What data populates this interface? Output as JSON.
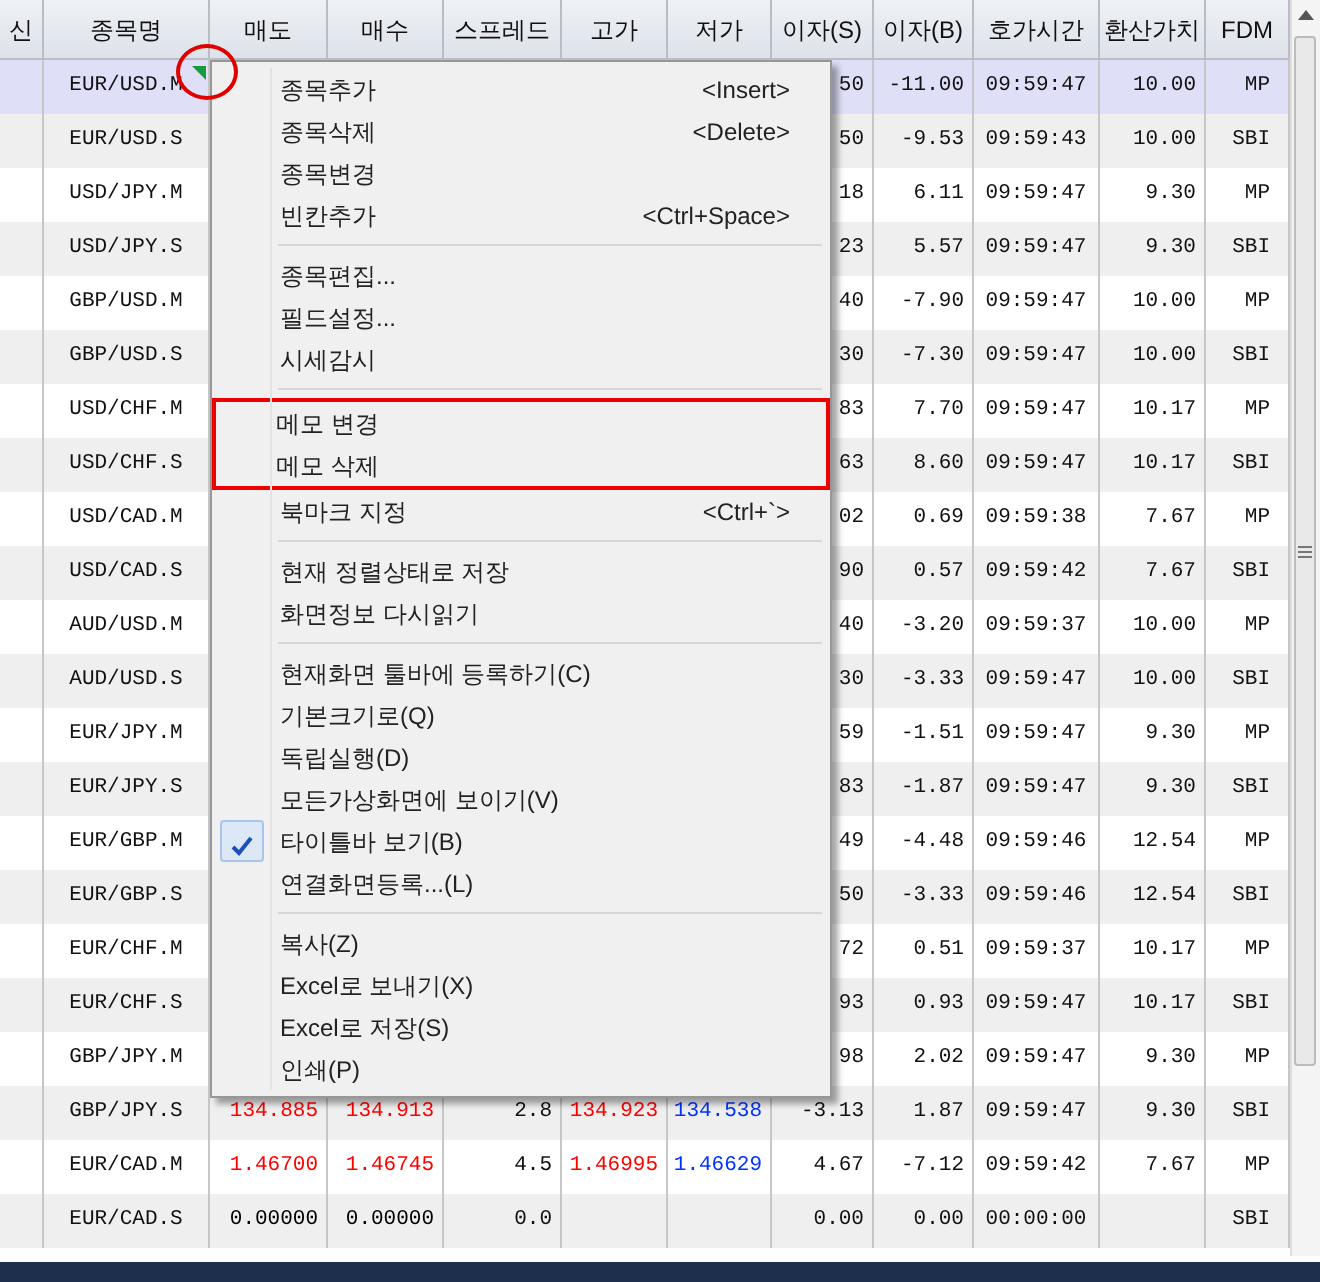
{
  "table": {
    "columns": [
      "신",
      "종목명",
      "매도",
      "매수",
      "스프레드",
      "고가",
      "저가",
      "이자(S)",
      "이자(B)",
      "호가시간",
      "환산가치",
      "FDM"
    ],
    "rows": [
      {
        "name": "EUR/USD.M",
        "interest_s": "50",
        "interest_b": "-11.00",
        "quote_time": "09:59:47",
        "converted_value": "10.00",
        "fdm": "MP",
        "selected": true,
        "memo": true
      },
      {
        "name": "EUR/USD.S",
        "interest_s": "50",
        "interest_b": "-9.53",
        "quote_time": "09:59:43",
        "converted_value": "10.00",
        "fdm": "SBI",
        "selected": false,
        "memo": false
      },
      {
        "name": "USD/JPY.M",
        "interest_s": "18",
        "interest_b": "6.11",
        "quote_time": "09:59:47",
        "converted_value": "9.30",
        "fdm": "MP",
        "selected": false,
        "memo": false
      },
      {
        "name": "USD/JPY.S",
        "interest_s": "23",
        "interest_b": "5.57",
        "quote_time": "09:59:47",
        "converted_value": "9.30",
        "fdm": "SBI",
        "selected": false,
        "memo": false
      },
      {
        "name": "GBP/USD.M",
        "interest_s": "40",
        "interest_b": "-7.90",
        "quote_time": "09:59:47",
        "converted_value": "10.00",
        "fdm": "MP",
        "selected": false,
        "memo": false
      },
      {
        "name": "GBP/USD.S",
        "interest_s": "30",
        "interest_b": "-7.30",
        "quote_time": "09:59:47",
        "converted_value": "10.00",
        "fdm": "SBI",
        "selected": false,
        "memo": false
      },
      {
        "name": "USD/CHF.M",
        "interest_s": "83",
        "interest_b": "7.70",
        "quote_time": "09:59:47",
        "converted_value": "10.17",
        "fdm": "MP",
        "selected": false,
        "memo": false
      },
      {
        "name": "USD/CHF.S",
        "interest_s": "63",
        "interest_b": "8.60",
        "quote_time": "09:59:47",
        "converted_value": "10.17",
        "fdm": "SBI",
        "selected": false,
        "memo": false
      },
      {
        "name": "USD/CAD.M",
        "interest_s": "02",
        "interest_b": "0.69",
        "quote_time": "09:59:38",
        "converted_value": "7.67",
        "fdm": "MP",
        "selected": false,
        "memo": false
      },
      {
        "name": "USD/CAD.S",
        "interest_s": "90",
        "interest_b": "0.57",
        "quote_time": "09:59:42",
        "converted_value": "7.67",
        "fdm": "SBI",
        "selected": false,
        "memo": false
      },
      {
        "name": "AUD/USD.M",
        "interest_s": "40",
        "interest_b": "-3.20",
        "quote_time": "09:59:37",
        "converted_value": "10.00",
        "fdm": "MP",
        "selected": false,
        "memo": false
      },
      {
        "name": "AUD/USD.S",
        "interest_s": "30",
        "interest_b": "-3.33",
        "quote_time": "09:59:47",
        "converted_value": "10.00",
        "fdm": "SBI",
        "selected": false,
        "memo": false
      },
      {
        "name": "EUR/JPY.M",
        "interest_s": "59",
        "interest_b": "-1.51",
        "quote_time": "09:59:47",
        "converted_value": "9.30",
        "fdm": "MP",
        "selected": false,
        "memo": false
      },
      {
        "name": "EUR/JPY.S",
        "interest_s": "83",
        "interest_b": "-1.87",
        "quote_time": "09:59:47",
        "converted_value": "9.30",
        "fdm": "SBI",
        "selected": false,
        "memo": false
      },
      {
        "name": "EUR/GBP.M",
        "interest_s": "49",
        "interest_b": "-4.48",
        "quote_time": "09:59:46",
        "converted_value": "12.54",
        "fdm": "MP",
        "selected": false,
        "memo": false
      },
      {
        "name": "EUR/GBP.S",
        "interest_s": "50",
        "interest_b": "-3.33",
        "quote_time": "09:59:46",
        "converted_value": "12.54",
        "fdm": "SBI",
        "selected": false,
        "memo": false
      },
      {
        "name": "EUR/CHF.M",
        "interest_s": "72",
        "interest_b": "0.51",
        "quote_time": "09:59:37",
        "converted_value": "10.17",
        "fdm": "MP",
        "selected": false,
        "memo": false
      },
      {
        "name": "EUR/CHF.S",
        "interest_s": "93",
        "interest_b": "0.93",
        "quote_time": "09:59:47",
        "converted_value": "10.17",
        "fdm": "SBI",
        "selected": false,
        "memo": false
      },
      {
        "name": "GBP/JPY.M",
        "interest_s": "98",
        "interest_b": "2.02",
        "quote_time": "09:59:47",
        "converted_value": "9.30",
        "fdm": "MP",
        "selected": false,
        "memo": false
      },
      {
        "name": "GBP/JPY.S",
        "bid": {
          "text": "134.885",
          "color": "#ff0000"
        },
        "ask": {
          "text": "134.913",
          "color": "#ff0000"
        },
        "spread": "2.8",
        "high": {
          "text": "134.923",
          "color": "#ff0000"
        },
        "low": {
          "text": "134.538",
          "color": "#0033ff"
        },
        "interest_s": "-3.13",
        "interest_b": "1.87",
        "quote_time": "09:59:47",
        "converted_value": "9.30",
        "fdm": "SBI",
        "selected": false,
        "memo": false
      },
      {
        "name": "EUR/CAD.M",
        "bid": {
          "text": "1.46700",
          "color": "#ff0000"
        },
        "ask": {
          "text": "1.46745",
          "color": "#ff0000"
        },
        "spread": "4.5",
        "high": {
          "text": "1.46995",
          "color": "#ff0000"
        },
        "low": {
          "text": "1.46629",
          "color": "#0033ff"
        },
        "interest_s": "4.67",
        "interest_b": "-7.12",
        "quote_time": "09:59:42",
        "converted_value": "7.67",
        "fdm": "MP",
        "selected": false,
        "memo": false
      },
      {
        "name": "EUR/CAD.S",
        "bid": {
          "text": "0.00000",
          "color": "#000000"
        },
        "ask": {
          "text": "0.00000",
          "color": "#000000"
        },
        "spread": "0.0",
        "interest_s": "0.00",
        "interest_b": "0.00",
        "quote_time": "00:00:00",
        "fdm": "SBI",
        "selected": false,
        "memo": false
      }
    ]
  },
  "context_menu": {
    "sections": [
      {
        "items": [
          {
            "label": "종목추가",
            "shortcut": "<Insert>",
            "checked": false,
            "annotated": false
          },
          {
            "label": "종목삭제",
            "shortcut": "<Delete>",
            "checked": false,
            "annotated": false
          },
          {
            "label": "종목변경",
            "checked": false,
            "annotated": false
          },
          {
            "label": "빈칸추가",
            "shortcut": "<Ctrl+Space>",
            "checked": false,
            "annotated": false
          }
        ]
      },
      {
        "items": [
          {
            "label": "종목편집...",
            "checked": false,
            "annotated": false
          },
          {
            "label": "필드설정...",
            "checked": false,
            "annotated": false
          },
          {
            "label": "시세감시",
            "checked": false,
            "annotated": false
          }
        ]
      },
      {
        "items": [
          {
            "label": "메모 변경",
            "checked": false,
            "annotated": true
          },
          {
            "label": "메모 삭제",
            "checked": false,
            "annotated": true
          },
          {
            "label": "북마크 지정",
            "shortcut": "<Ctrl+`>",
            "checked": false,
            "annotated": false
          }
        ]
      },
      {
        "items": [
          {
            "label": "현재 정렬상태로 저장",
            "checked": false,
            "annotated": false
          },
          {
            "label": "화면정보 다시읽기",
            "checked": false,
            "annotated": false
          }
        ]
      },
      {
        "items": [
          {
            "label": "현재화면 툴바에 등록하기(C)",
            "checked": false,
            "annotated": false
          },
          {
            "label": "기본크기로(Q)",
            "checked": false,
            "annotated": false
          },
          {
            "label": "독립실행(D)",
            "checked": false,
            "annotated": false
          },
          {
            "label": "모든가상화면에 보이기(V)",
            "checked": false,
            "annotated": false
          },
          {
            "label": "타이틀바 보기(B)",
            "checked": true,
            "annotated": false
          },
          {
            "label": "연결화면등록...(L)",
            "checked": false,
            "annotated": false
          }
        ]
      },
      {
        "items": [
          {
            "label": "복사(Z)",
            "checked": false,
            "annotated": false
          },
          {
            "label": "Excel로 보내기(X)",
            "checked": false,
            "annotated": false
          },
          {
            "label": "Excel로 저장(S)",
            "checked": false,
            "annotated": false
          },
          {
            "label": "인쇄(P)",
            "checked": false,
            "annotated": false
          }
        ]
      }
    ]
  }
}
